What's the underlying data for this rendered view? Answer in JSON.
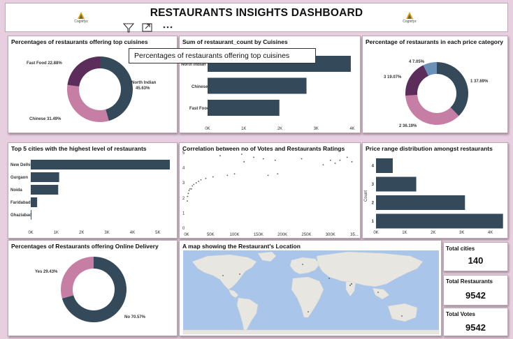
{
  "header": {
    "title": "RESTAURANTS INSIGHTS DASHBOARD",
    "logo_left_text": "Cognifyz",
    "logo_right_text": "Cognifyz"
  },
  "toolbar": {
    "icons": [
      "filter-icon",
      "focus-mode-icon",
      "more-options-icon"
    ]
  },
  "tooltip": {
    "text": "Percentages of restaurants offering top cuisines"
  },
  "colors": {
    "dark": "#34495a",
    "pink": "#c67ea5",
    "purple": "#5c2d5b",
    "blue": "#6b91b8"
  },
  "cards": {
    "cuisines_pct": {
      "title": "Percentages of restaurants offering top cuisines",
      "labels": {
        "fast_food": "Fast Food 22.88%",
        "north_indian_1": "North Indian",
        "north_indian_2": "45.63%",
        "chinese": "Chinese 31.49%"
      }
    },
    "cuisine_sum": {
      "title": "Sum of restaurant_count by Cuisines",
      "category_top": "North Indian",
      "category_mid": "Chinese",
      "category_bottom": "Fast Food"
    },
    "price_cat": {
      "title": "Percentage of restaurants in each price category",
      "labels": {
        "s4": "4 7.05%",
        "s3": "3 19.07%",
        "s1": "1 37.69%",
        "s2": "2 36.19%"
      }
    },
    "top_cities": {
      "title": "Top 5 cities with the highest level of restaurants"
    },
    "votes_rating": {
      "title": "Correlation between no of Votes and Restaurants Ratings"
    },
    "price_range": {
      "title": "Price range distribution amongst restaurants",
      "yaxis_label": "Count"
    },
    "online_delivery": {
      "title": "Percentages of Restaurants offering Online Delivery",
      "labels": {
        "yes": "Yes 29.43%",
        "no": "No 70.57%"
      }
    },
    "map": {
      "title": "A map showing the Restaurant's Location"
    },
    "kpis": {
      "total_cities_label": "Total cities",
      "total_cities_value": "140",
      "total_restaurants_label": "Total Restaurants",
      "total_restaurants_value": "9542",
      "total_votes_label": "Total Votes",
      "total_votes_value": "9542"
    }
  },
  "chart_data": [
    {
      "type": "pie",
      "title": "Percentages of restaurants offering top cuisines",
      "categories": [
        "North Indian",
        "Chinese",
        "Fast Food"
      ],
      "values": [
        45.63,
        31.49,
        22.88
      ],
      "colors": [
        "#34495a",
        "#c67ea5",
        "#5c2d5b"
      ]
    },
    {
      "type": "bar",
      "title": "Sum of restaurant_count by Cuisines",
      "orientation": "horizontal",
      "categories": [
        "North Indian",
        "Chinese",
        "Fast Food"
      ],
      "values": [
        3960,
        2735,
        1985
      ],
      "xlim": [
        0,
        4000
      ],
      "xticks": [
        "0K",
        "1K",
        "2K",
        "3K",
        "4K"
      ]
    },
    {
      "type": "pie",
      "title": "Percentage of restaurants in each price category",
      "categories": [
        "1",
        "2",
        "3",
        "4"
      ],
      "values": [
        37.69,
        36.19,
        19.07,
        7.05
      ],
      "colors": [
        "#34495a",
        "#c67ea5",
        "#5c2d5b",
        "#6b91b8"
      ]
    },
    {
      "type": "bar",
      "title": "Top 5 cities with the highest level of restaurants",
      "orientation": "horizontal",
      "categories": [
        "New Delhi",
        "Gurgaon",
        "Noida",
        "Faridabad",
        "Ghaziabad"
      ],
      "values": [
        5473,
        1118,
        1080,
        251,
        25
      ],
      "xlim": [
        0,
        5500
      ],
      "xticks": [
        "0K",
        "1K",
        "2K",
        "3K",
        "4K",
        "5K"
      ]
    },
    {
      "type": "scatter",
      "title": "Correlation between no of Votes and Restaurants Ratings",
      "points": [
        [
          1500,
          1.8
        ],
        [
          2000,
          2.1
        ],
        [
          3500,
          2.3
        ],
        [
          5000,
          2.5
        ],
        [
          7000,
          2.6
        ],
        [
          10000,
          2.6
        ],
        [
          12000,
          2.8
        ],
        [
          15000,
          2.9
        ],
        [
          20000,
          3.0
        ],
        [
          25000,
          3.1
        ],
        [
          30000,
          3.2
        ],
        [
          40000,
          3.3
        ],
        [
          55000,
          3.4
        ],
        [
          70000,
          4.8
        ],
        [
          85000,
          3.5
        ],
        [
          100000,
          3.6
        ],
        [
          115000,
          4.9
        ],
        [
          120000,
          4.4
        ],
        [
          140000,
          4.7
        ],
        [
          160000,
          4.6
        ],
        [
          170000,
          3.5
        ],
        [
          185000,
          4.5
        ],
        [
          190000,
          3.6
        ],
        [
          240000,
          4.6
        ],
        [
          285000,
          4.2
        ],
        [
          300000,
          4.5
        ],
        [
          310000,
          4.3
        ],
        [
          320000,
          4.5
        ],
        [
          335000,
          4.7
        ],
        [
          345000,
          4.4
        ]
      ],
      "ylim": [
        0,
        5
      ],
      "yticks": [
        "0",
        "1",
        "2",
        "3",
        "4",
        "5"
      ],
      "xticks": [
        "0K",
        "50K",
        "100K",
        "150K",
        "200K",
        "250K",
        "300K",
        "35..."
      ]
    },
    {
      "type": "bar",
      "title": "Price range distribution amongst restaurants",
      "orientation": "horizontal",
      "categories": [
        "4",
        "3",
        "2",
        "1"
      ],
      "values": [
        586,
        1408,
        3113,
        4444
      ],
      "xlim": [
        0,
        4500
      ],
      "xticks": [
        "0K",
        "1K",
        "2K",
        "3K",
        "4K"
      ]
    },
    {
      "type": "pie",
      "title": "Percentages of Restaurants offering Online Delivery",
      "categories": [
        "No",
        "Yes"
      ],
      "values": [
        70.57,
        29.43
      ],
      "colors": [
        "#34495a",
        "#c67ea5"
      ]
    }
  ]
}
